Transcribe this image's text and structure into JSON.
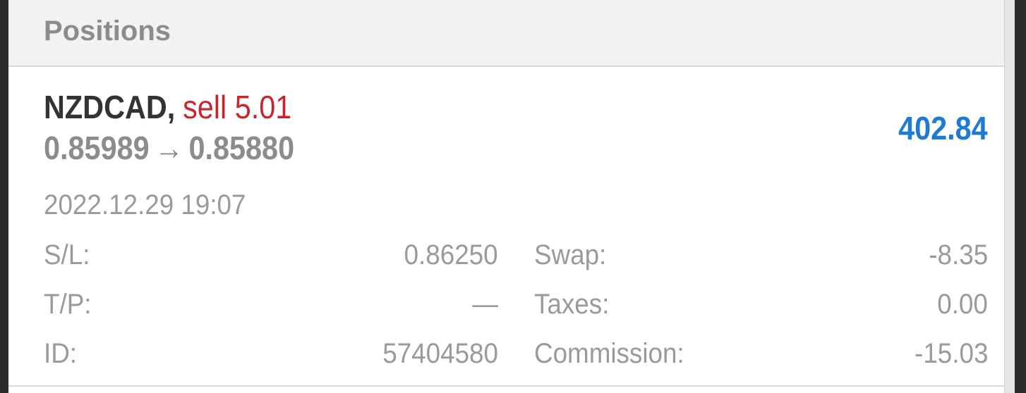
{
  "section": {
    "title": "Positions"
  },
  "position": {
    "symbol": "NZDCAD",
    "separator": ",",
    "side": "sell 5.01",
    "open_price": "0.85989",
    "arrow": "→",
    "current_price": "0.85880",
    "profit": "402.84",
    "open_time": "2022.12.29 19:07",
    "details_left": [
      {
        "label": "S/L:",
        "value": "0.86250"
      },
      {
        "label": "T/P:",
        "value": "—"
      },
      {
        "label": "ID:",
        "value": "57404580"
      }
    ],
    "details_right": [
      {
        "label": "Swap:",
        "value": "-8.35"
      },
      {
        "label": "Taxes:",
        "value": "0.00"
      },
      {
        "label": "Commission:",
        "value": "-15.03"
      }
    ]
  },
  "colors": {
    "sell": "#c8262c",
    "profit_positive": "#1f7bd1",
    "muted_text": "#9a9a9a"
  }
}
